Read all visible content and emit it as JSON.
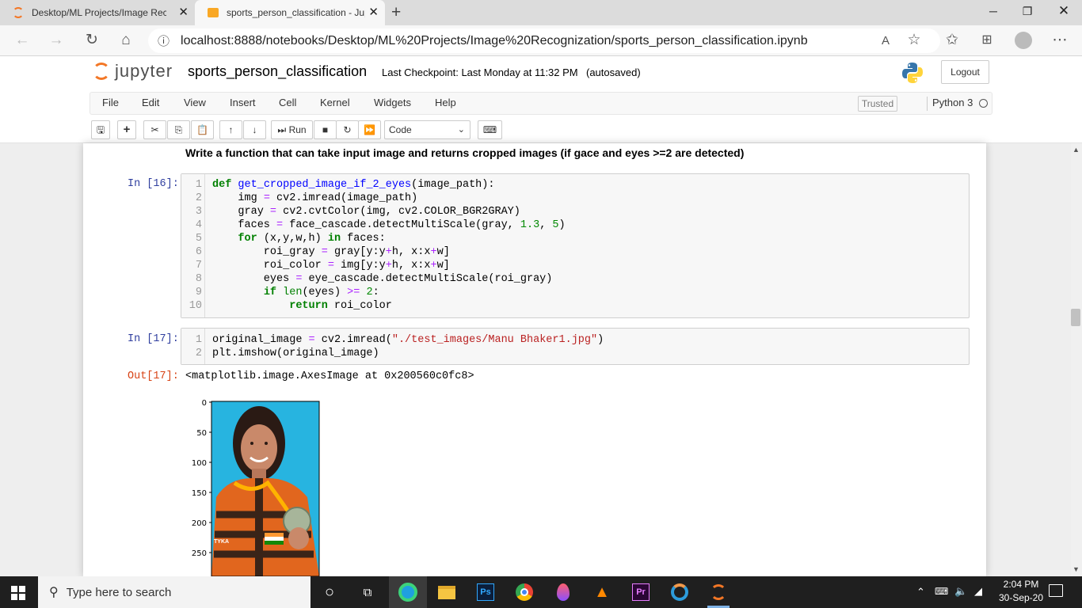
{
  "browser": {
    "tabs": [
      {
        "title": "Desktop/ML Projects/Image Rec"
      },
      {
        "title": "sports_person_classification - Jup"
      }
    ],
    "url": "localhost:8888/notebooks/Desktop/ML%20Projects/Image%20Recognization/sports_person_classification.ipynb"
  },
  "jupyter": {
    "logo_text": "jupyter",
    "notebook_name": "sports_person_classification",
    "checkpoint": "Last Checkpoint: Last Monday at 11:32 PM",
    "autosaved": "(autosaved)",
    "logout": "Logout",
    "menus": [
      "File",
      "Edit",
      "View",
      "Insert",
      "Cell",
      "Kernel",
      "Widgets",
      "Help"
    ],
    "trusted": "Trusted",
    "kernel": "Python 3",
    "run_label": "Run",
    "cell_type": "Code"
  },
  "notebook": {
    "markdown": "Write a function that can take input image and returns cropped images (if gace and eyes >=2 are detected)",
    "cell16": {
      "prompt": "In [16]:",
      "lines": [
        "def get_cropped_image_if_2_eyes(image_path):",
        "    img = cv2.imread(image_path)",
        "    gray = cv2.cvtColor(img, cv2.COLOR_BGR2GRAY)",
        "    faces = face_cascade.detectMultiScale(gray, 1.3, 5)",
        "    for (x,y,w,h) in faces:",
        "        roi_gray = gray[y:y+h, x:x+w]",
        "        roi_color = img[y:y+h, x:x+w]",
        "        eyes = eye_cascade.detectMultiScale(roi_gray)",
        "        if len(eyes) >= 2:",
        "            return roi_color"
      ]
    },
    "cell17": {
      "prompt": "In [17]:",
      "lines": [
        "original_image = cv2.imread(\"./test_images/Manu Bhaker1.jpg\")",
        "plt.imshow(original_image)"
      ],
      "out_prompt": "Out[17]:",
      "output": "<matplotlib.image.AxesImage at 0x200560c0fc8>",
      "plot_yticks": [
        "0",
        "50",
        "100",
        "150",
        "200",
        "250"
      ],
      "badge": "TYKA"
    }
  },
  "taskbar": {
    "search_placeholder": "Type here to search",
    "time": "2:04 PM",
    "date": "30-Sep-20"
  }
}
